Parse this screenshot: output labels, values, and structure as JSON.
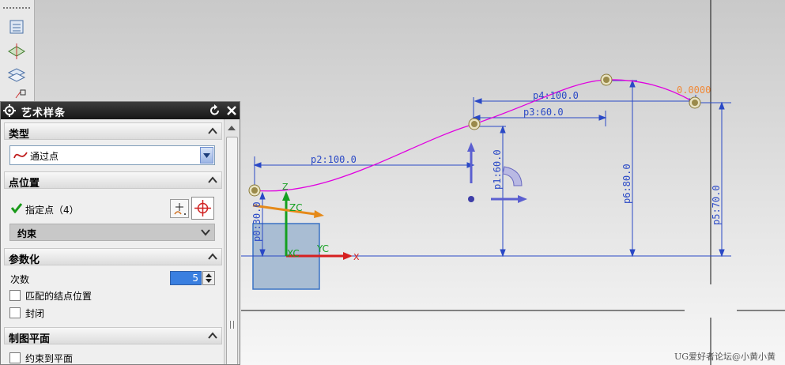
{
  "dialog": {
    "title": "艺术样条",
    "sections": {
      "type": {
        "header": "类型",
        "selected": "通过点"
      },
      "point_position": {
        "header": "点位置",
        "specify_points": "指定点（4）",
        "constraint_group": "约束"
      },
      "parameterization": {
        "header": "参数化",
        "degree_label": "次数",
        "degree_value": "5",
        "match_knots_label": "匹配的结点位置",
        "closed_label": "封闭"
      },
      "drawing_plane": {
        "header": "制图平面",
        "constrain_to_plane_label": "约束到平面"
      }
    }
  },
  "viewport": {
    "dimensions": {
      "p2": "p2:100.0",
      "p3": "p3:60.0",
      "p4": "p4:100.0",
      "p0": "p0:30.0",
      "p1": "p1:60.0",
      "p6": "p6:80.0",
      "p5": "p5:70.0",
      "endpoint_value": "0.0000"
    },
    "axes": {
      "xc": "XC",
      "yc": "YC",
      "zc": "ZC",
      "x": "X",
      "z": "Z"
    },
    "watermark": "UG爱好者论坛@小黄小黄"
  },
  "colors": {
    "spline": "#e000e0",
    "dimension": "#2a49c6",
    "dialog_titlebar": "#1f1f1f",
    "axis_x": "#d62020",
    "axis_y": "#14a020",
    "axis_z": "#e58a1a"
  }
}
